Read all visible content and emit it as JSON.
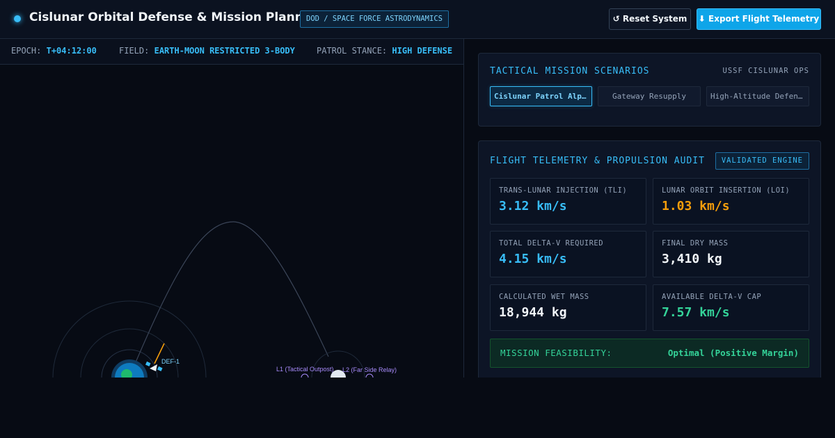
{
  "header": {
    "title": "Cislunar Orbital Defense & Mission Planner",
    "badge": "DOD / SPACE FORCE ASTRODYNAMICS",
    "reset_label": "↺ Reset System",
    "export_label": "⬇ Export Flight Telemetry"
  },
  "sim": {
    "epoch_label": "EPOCH:",
    "epoch_value": "T+04:12:00",
    "field_label": "FIELD:",
    "field_value": "EARTH-MOON RESTRICTED 3-BODY",
    "stance_label": "PATROL STANCE:",
    "stance_value": "HIGH DEFENSE",
    "spacecraft_label": "DEF-1",
    "l1_label": "L1 (Tactical Outpost)",
    "l2_label": "L2 (Far Side Relay)"
  },
  "scenarios": {
    "title": "TACTICAL MISSION SCENARIOS",
    "subtitle": "USSF CISLUNAR OPS",
    "tabs": [
      {
        "label": "Cislunar Patrol Alpha",
        "active": true
      },
      {
        "label": "Gateway Resupply",
        "active": false
      },
      {
        "label": "High-Altitude Defense",
        "active": false
      }
    ]
  },
  "telemetry": {
    "title": "FLIGHT TELEMETRY & PROPULSION AUDIT",
    "badge": "VALIDATED ENGINE",
    "metrics": [
      {
        "label": "TRANS-LUNAR INJECTION (TLI)",
        "value": "3.12 km/s",
        "color": "#38bdf8"
      },
      {
        "label": "LUNAR ORBIT INSERTION (LOI)",
        "value": "1.03 km/s",
        "color": "#f59e0b"
      },
      {
        "label": "TOTAL DELTA-V REQUIRED",
        "value": "4.15 km/s",
        "color": "#38bdf8"
      },
      {
        "label": "FINAL DRY MASS",
        "value": "3,410 kg",
        "color": "#f1f5f9"
      },
      {
        "label": "CALCULATED WET MASS",
        "value": "18,944 kg",
        "color": "#f1f5f9"
      },
      {
        "label": "AVAILABLE DELTA-V CAP",
        "value": "7.57 km/s",
        "color": "#34d399"
      }
    ],
    "feasibility_label": "MISSION FEASIBILITY:",
    "feasibility_value": "Optimal (Positive Margin)"
  }
}
